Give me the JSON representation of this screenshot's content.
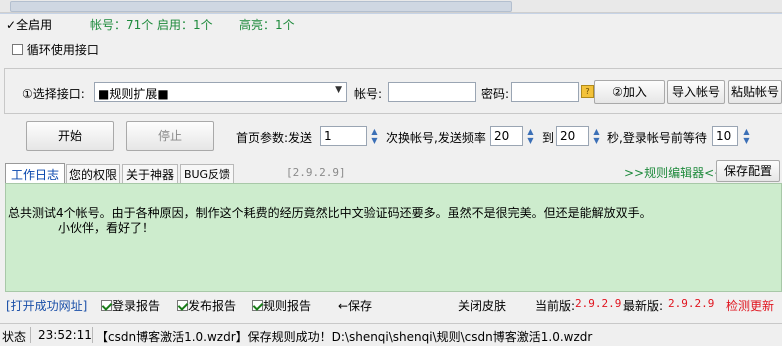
{
  "top_stats": {
    "all_enable": "全启用",
    "accounts": "帐号：71个",
    "enabled": "启用：1个",
    "highlight": "高亮：1个"
  },
  "loop_interface_label": "循环使用接口",
  "select_row": {
    "select_label": "①选择接口:",
    "select_value": "■规则扩展■",
    "account_label": "帐号:",
    "account_value": "",
    "password_label": "密码:",
    "password_value": "",
    "add_button": "②加入",
    "import_button": "导入帐号",
    "paste_button": "粘贴帐号"
  },
  "control_row": {
    "start_button": "开始",
    "stop_button": "停止",
    "params_label": "首页参数:发送",
    "send_count": "1",
    "text_switch": "次换帐号,发送频率",
    "freq_from": "20",
    "text_to": "到",
    "freq_to": "20",
    "text_wait": "秒,登录帐号前等待",
    "wait_value": "10"
  },
  "tabs": {
    "log": "工作日志",
    "permission": "您的权限",
    "about": "关于神器",
    "bug": "BUG反馈",
    "version": "[2.9.2.9]",
    "rule_editor": ">>规则编辑器<<",
    "save_config": "保存配置"
  },
  "log": {
    "line1": "总共测试4个帐号。由于各种原因，制作这个耗费的经历竟然比中文验证码还要多。虽然不是很完美。但还是能解放双手。",
    "line2": "小伙伴，看好了！"
  },
  "bottom_bar": {
    "open_url": "[打开成功网址]",
    "login_report": "登录报告",
    "publish_report": "发布报告",
    "rule_report": "规则报告",
    "save": "←保存",
    "close_skin": "关闭皮肤",
    "current_version_label": "当前版:",
    "current_version": "2.9.2.9",
    "latest_version_label": "最新版:",
    "latest_version": "2.9.2.9",
    "check_update": "检测更新"
  },
  "status_bar": {
    "status_label": "状态",
    "time": "23:52:11",
    "message": "【csdn博客激活1.0.wzdr】保存规则成功！D:\\shenqi\\shenqi\\规则\\csdn博客激活1.0.wzdr"
  },
  "colors": {
    "log_background": "#cdeccd",
    "version_red": "#e0141e",
    "stats_green": "#1e8a3c",
    "link_blue": "#1a4fa8"
  }
}
